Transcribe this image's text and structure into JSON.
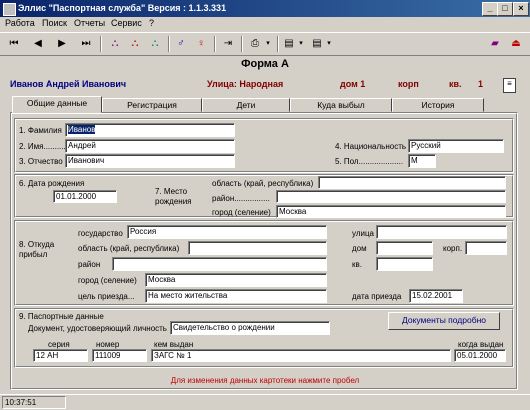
{
  "window": {
    "title": "Эллис \"Паспортная служба\" Версия : 1.1.3.331"
  },
  "menu": [
    "Работа",
    "Поиск",
    "Отчеты",
    "Сервис",
    "?"
  ],
  "header": {
    "person": "Иванов Андрей Иванович",
    "street": "Улица: Народная",
    "house": "дом 1",
    "korp": "корп",
    "kv": "кв.",
    "kv_value": "1",
    "form_title": "Форма А"
  },
  "tabs": [
    "Общие данные",
    "Регистрация",
    "Дети",
    "Куда выбыл",
    "История"
  ],
  "personal": {
    "surname_label": "1. Фамилия",
    "surname": "Иванов",
    "name_label": "2. Имя..........",
    "name": "Андрей",
    "patronymic_label": "3. Отчество",
    "patronymic": "Иванович",
    "nationality_label": "4. Национальность",
    "nationality": "Русский",
    "sex_label": "5. Пол....................",
    "sex": "М"
  },
  "birth": {
    "date_label": "6. Дата рождения",
    "date": "01.01.2000",
    "place_label": "7. Место рождения",
    "region_label": "область (край, республика)",
    "region": "",
    "district_label": "район................",
    "district": "",
    "city_label": "город (селение)",
    "city": "Москва"
  },
  "arrival": {
    "label": "8. Откуда прибыл",
    "country_label": "государство",
    "country": "Россия",
    "region_label": "область (край, республика)",
    "region": "",
    "district_label": "район",
    "district": "",
    "city_label": "город (селение)",
    "city": "Москва",
    "purpose_label": "цель приезда...",
    "purpose": "На место жительства",
    "street_label": "улица",
    "street": "",
    "house_label": "дом",
    "house": "",
    "korp_label": "корп.",
    "korp": "",
    "kv_label": "кв.",
    "kv": "",
    "date_label": "дата приезда",
    "date": "15.02.2001"
  },
  "passport": {
    "label": "9. Паспортные данные",
    "doc_label": "Документ, удостоверяющий личность",
    "doc": "Свидетельство о рождении",
    "details_button": "Документы подробно",
    "series_label": "серия",
    "series": "12 АН",
    "number_label": "номер",
    "number": "111009",
    "issuer_label": "кем выдан",
    "issuer": "ЗАГС № 1",
    "issued_label": "когда выдан",
    "issued": "05.01.2000"
  },
  "hint": "Для изменения данных картотеки нажмите пробел",
  "status": {
    "time": "10:37:51"
  }
}
